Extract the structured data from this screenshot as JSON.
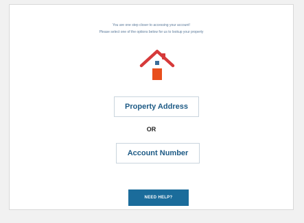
{
  "intro": {
    "line1": "You are one step closer to accessing your account!",
    "line2": "Please select one of the options below for us to lookup your property"
  },
  "icons": {
    "house": "house-icon"
  },
  "colors": {
    "roof": "#d63a3a",
    "door": "#e84e1c",
    "window": "#3c6e9a",
    "help_button_bg": "#1b6c9b",
    "option_text": "#1d5a85"
  },
  "options": {
    "address_label": "Property Address",
    "separator": "OR",
    "account_label": "Account Number"
  },
  "help": {
    "label": "NEED HELP?"
  }
}
